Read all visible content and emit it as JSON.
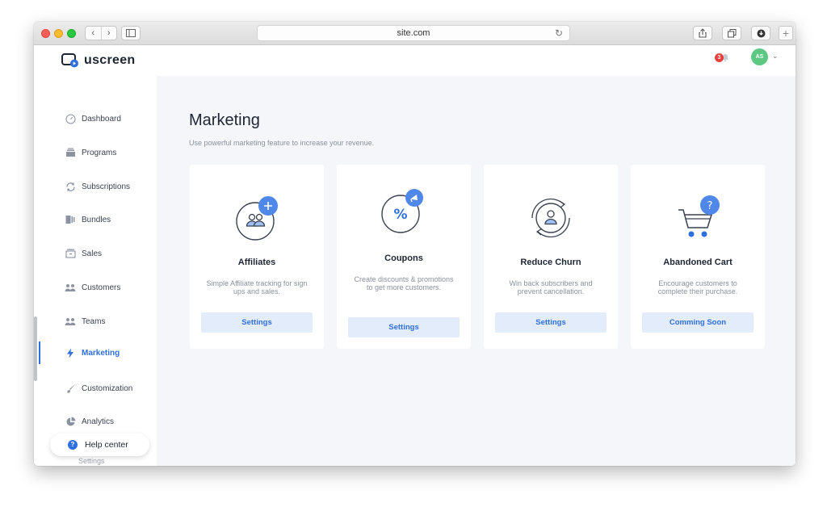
{
  "browser": {
    "url": "site.com",
    "back": "‹",
    "forward": "›",
    "reload": "↻",
    "plus": "+"
  },
  "header": {
    "logo_text": "uscreen",
    "notification_count": "3",
    "avatar_initials": "AS"
  },
  "sidebar": {
    "items": [
      {
        "label": "Dashboard",
        "icon": "speedometer-icon"
      },
      {
        "label": "Programs",
        "icon": "programs-icon"
      },
      {
        "label": "Subscriptions",
        "icon": "refresh-icon"
      },
      {
        "label": "Bundles",
        "icon": "bundles-icon"
      },
      {
        "label": "Sales",
        "icon": "sales-icon"
      },
      {
        "label": "Customers",
        "icon": "users-icon"
      },
      {
        "label": "Teams",
        "icon": "team-icon"
      },
      {
        "label": "Marketing",
        "icon": "lightning-icon",
        "active": true
      },
      {
        "label": "Customization",
        "icon": "brush-icon"
      },
      {
        "label": "Analytics",
        "icon": "pie-icon"
      }
    ],
    "help_label": "Help center",
    "help_icon": "?",
    "peek_label": "Settings"
  },
  "main": {
    "title": "Marketing",
    "subtitle": "Use powerful marketing feature to increase your revenue.",
    "cards": [
      {
        "title": "Affiliates",
        "description": "Simple Affiliate tracking for sign ups and sales.",
        "button": "Settings"
      },
      {
        "title": "Coupons",
        "description": "Create discounts & promotions to get more customers.",
        "button": "Settings"
      },
      {
        "title": "Reduce Churn",
        "description": "Win back subscribers and prevent cancellation.",
        "button": "Settings"
      },
      {
        "title": "Abandoned Cart",
        "description": "Encourage customers to complete their purchase.",
        "button": "Comming Soon"
      }
    ]
  },
  "colors": {
    "accent": "#2f6fdf",
    "button_bg": "#e3ecfb",
    "main_bg": "#f4f6fa",
    "avatar": "#5cc882",
    "badge": "#e8413c"
  }
}
